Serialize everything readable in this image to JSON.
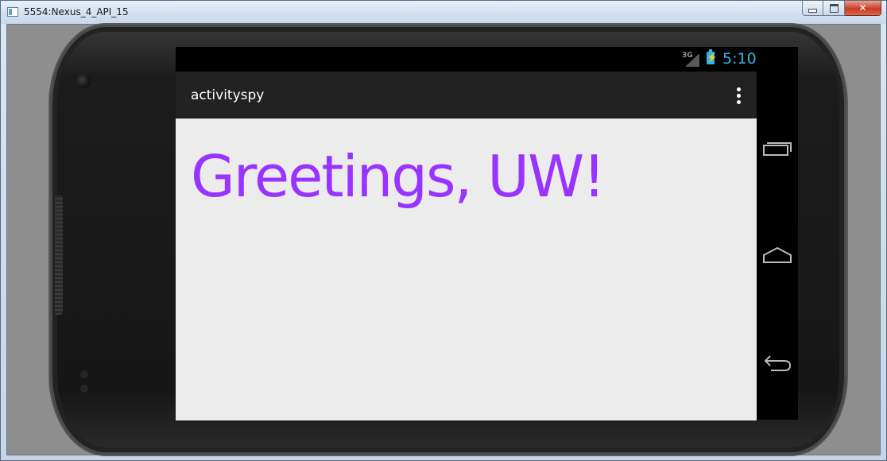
{
  "window": {
    "title": "5554:Nexus_4_API_15",
    "controls": {
      "minimize_icon": "minimize-icon",
      "maximize_icon": "maximize-icon",
      "close_icon": "close-icon",
      "close_glyph": "✕"
    }
  },
  "statusbar": {
    "network": "3G",
    "time": "5:10",
    "icons": [
      "signal-icon",
      "battery-charging-icon"
    ],
    "accent_color": "#33b5e5"
  },
  "actionbar": {
    "title": "activityspy",
    "overflow_icon": "overflow-menu-icon"
  },
  "content": {
    "greeting": "Greetings, UW!",
    "greeting_color": "#9933ff"
  },
  "navbar": {
    "buttons": [
      "recent-apps-icon",
      "home-icon",
      "back-icon"
    ]
  }
}
